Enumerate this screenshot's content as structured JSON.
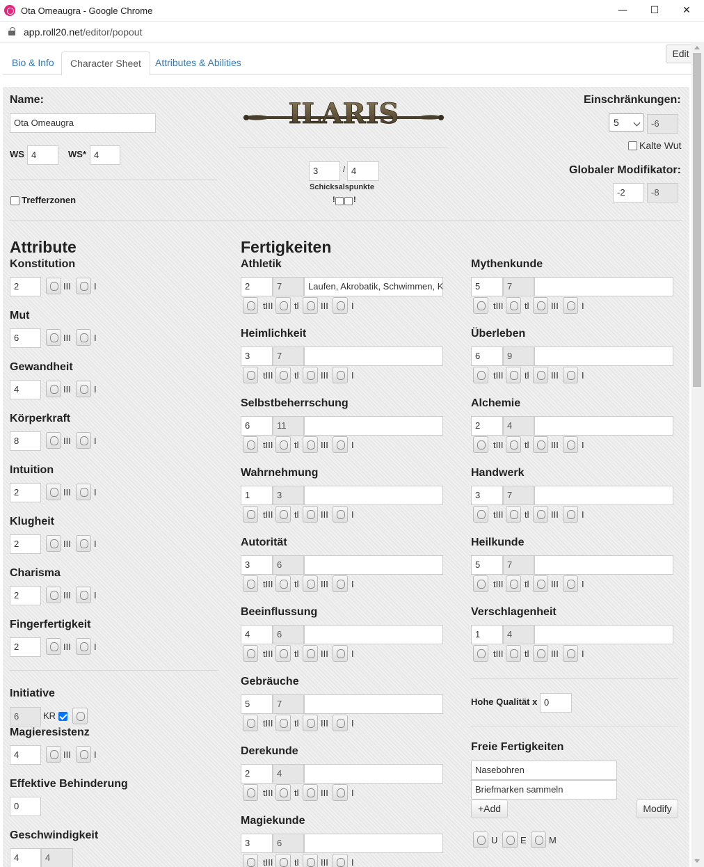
{
  "window": {
    "title": "Ota Omeaugra - Google Chrome",
    "url_host": "app.roll20.net",
    "url_path": "/editor/popout",
    "minimize": "—",
    "maximize": "☐",
    "close": "✕"
  },
  "tabs": [
    {
      "label": "Bio & Info"
    },
    {
      "label": "Character Sheet"
    },
    {
      "label": "Attributes & Abilities"
    }
  ],
  "edit_label": "Edit",
  "header": {
    "name_label": "Name:",
    "name_value": "Ota Omeaugra",
    "ws_label": "WS",
    "ws_value": "4",
    "ws_star_label": "WS*",
    "ws_star_value": "4",
    "trefferzonen_label": "Trefferzonen",
    "logo_text": "ILARIS",
    "schicksal_current": "3",
    "schicksal_sep": "/",
    "schicksal_max": "4",
    "schicksal_label": "Schicksalspunkte",
    "schicksal_marks_left": "!",
    "schicksal_marks_right": "!",
    "einschraenkungen_label": "Einschränkungen:",
    "einschraenkungen_select": "5",
    "einschraenkungen_value": "-6",
    "kalte_wut_label": "Kalte Wut",
    "globaler_label": "Globaler Modifikator:",
    "globaler_value": "-2",
    "globaler_total": "-8"
  },
  "dice_labels": {
    "three": "III",
    "one": "I",
    "t3": "tIII",
    "t1": "tl"
  },
  "attributes": {
    "title": "Attribute",
    "items": [
      {
        "label": "Konstitution",
        "value": "2"
      },
      {
        "label": "Mut",
        "value": "6"
      },
      {
        "label": "Gewandheit",
        "value": "4"
      },
      {
        "label": "Körperkraft",
        "value": "8"
      },
      {
        "label": "Intuition",
        "value": "2"
      },
      {
        "label": "Klugheit",
        "value": "2"
      },
      {
        "label": "Charisma",
        "value": "2"
      },
      {
        "label": "Fingerfertigkeit",
        "value": "2"
      }
    ]
  },
  "derived": {
    "initiative_label": "Initiative",
    "initiative_value": "6",
    "kr_label": "KR",
    "magieresistenz_label": "Magieresistenz",
    "magieresistenz_value": "4",
    "behinderung_label": "Effektive Behinderung",
    "behinderung_value": "0",
    "geschwindigkeit_label": "Geschwindigkeit",
    "geschwindigkeit_value": "4",
    "geschwindigkeit_total": "4"
  },
  "skills": {
    "title": "Fertigkeiten",
    "col1": [
      {
        "label": "Athletik",
        "value": "2",
        "total": "7",
        "talents": "Laufen, Akrobatik, Schwimmen, K"
      },
      {
        "label": "Heimlichkeit",
        "value": "3",
        "total": "7",
        "talents": ""
      },
      {
        "label": "Selbstbeherrschung",
        "value": "6",
        "total": "11",
        "talents": ""
      },
      {
        "label": "Wahrnehmung",
        "value": "1",
        "total": "3",
        "talents": ""
      },
      {
        "label": "Autorität",
        "value": "3",
        "total": "6",
        "talents": ""
      },
      {
        "label": "Beeinflussung",
        "value": "4",
        "total": "6",
        "talents": ""
      },
      {
        "label": "Gebräuche",
        "value": "5",
        "total": "7",
        "talents": ""
      },
      {
        "label": "Derekunde",
        "value": "2",
        "total": "4",
        "talents": ""
      },
      {
        "label": "Magiekunde",
        "value": "3",
        "total": "6",
        "talents": ""
      }
    ],
    "col2": [
      {
        "label": "Mythenkunde",
        "value": "5",
        "total": "7",
        "talents": ""
      },
      {
        "label": "Überleben",
        "value": "6",
        "total": "9",
        "talents": ""
      },
      {
        "label": "Alchemie",
        "value": "2",
        "total": "4",
        "talents": ""
      },
      {
        "label": "Handwerk",
        "value": "3",
        "total": "7",
        "talents": ""
      },
      {
        "label": "Heilkunde",
        "value": "5",
        "total": "7",
        "talents": ""
      },
      {
        "label": "Verschlagenheit",
        "value": "1",
        "total": "4",
        "talents": ""
      }
    ]
  },
  "hohe_qualitaet": {
    "label": "Hohe Qualität x",
    "value": "0"
  },
  "freie": {
    "title": "Freie Fertigkeiten",
    "items": [
      "Nasebohren",
      "Briefmarken sammeln"
    ],
    "add_label": "+Add",
    "modify_label": "Modify",
    "roll_labels": [
      "U",
      "E",
      "M"
    ]
  }
}
